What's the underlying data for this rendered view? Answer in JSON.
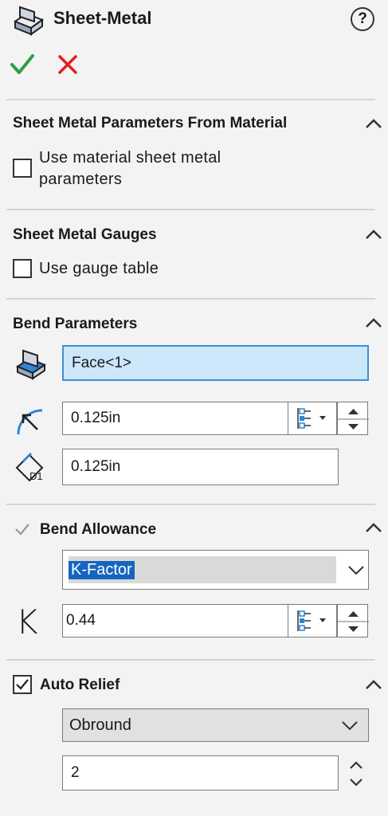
{
  "header": {
    "title": "Sheet-Metal",
    "help_label": "?"
  },
  "actions": {
    "ok_icon": "green-checkmark-icon",
    "cancel_icon": "red-x-icon"
  },
  "sections": {
    "material": {
      "title": "Sheet Metal Parameters From Material",
      "checkbox_label_line1": "Use material sheet metal",
      "checkbox_label_line2": "parameters",
      "checked": false
    },
    "gauges": {
      "title": "Sheet Metal Gauges",
      "checkbox_label": "Use gauge table",
      "checked": false
    },
    "bend_params": {
      "title": "Bend Parameters",
      "face_value": "Face<1>",
      "radius_value": "0.125in",
      "thickness_value": "0.125in"
    },
    "bend_allowance": {
      "title": "Bend Allowance",
      "enabled_checked": true,
      "type_value": "K-Factor",
      "k_symbol": "K",
      "k_value": "0.44"
    },
    "auto_relief": {
      "title": "Auto Relief",
      "checked": true,
      "type_value": "Obround",
      "ratio_value": "2"
    }
  },
  "colors": {
    "accent_blue": "#3f8fd2",
    "selected_field_bg": "#cce6fa",
    "ok_green": "#2ea043",
    "cancel_red": "#e02020"
  }
}
